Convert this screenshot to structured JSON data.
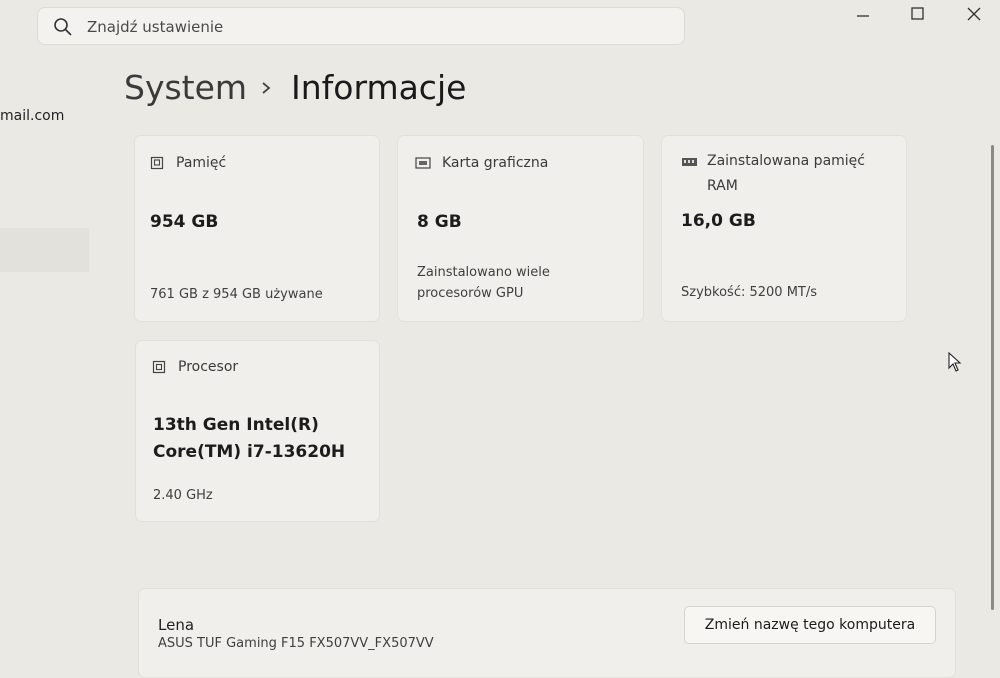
{
  "search": {
    "placeholder": "Znajdź ustawienie",
    "icon": "search-icon"
  },
  "window_controls": [
    "minimize-icon",
    "maximize-icon",
    "close-icon"
  ],
  "breadcrumb": {
    "parent": "System",
    "current": "Informacje"
  },
  "sidebar": {
    "email_fragment": "mail.com"
  },
  "cards": {
    "storage": {
      "label": "Pamięć",
      "value": "954 GB",
      "sub": "761 GB z 954 GB używane"
    },
    "gpu": {
      "label": "Karta graficzna",
      "value": "8 GB",
      "sub_line1": "Zainstalowano wiele",
      "sub_line2": "procesorów GPU"
    },
    "ram": {
      "label_line1": "Zainstalowana pamięć",
      "label_line2": "RAM",
      "value": "16,0 GB",
      "sub": "Szybkość: 5200 MT/s"
    },
    "cpu": {
      "label": "Procesor",
      "value_line1": "13th Gen Intel(R)",
      "value_line2": "Core(TM) i7-13620H",
      "sub": "2.40 GHz"
    }
  },
  "device": {
    "name": "Lena",
    "model": "ASUS TUF Gaming F15 FX507VV_FX507VV",
    "rename_label": "Zmień nazwę tego komputera"
  },
  "colors": {
    "background": "#ebe9e4",
    "card": "#f0efeb"
  }
}
